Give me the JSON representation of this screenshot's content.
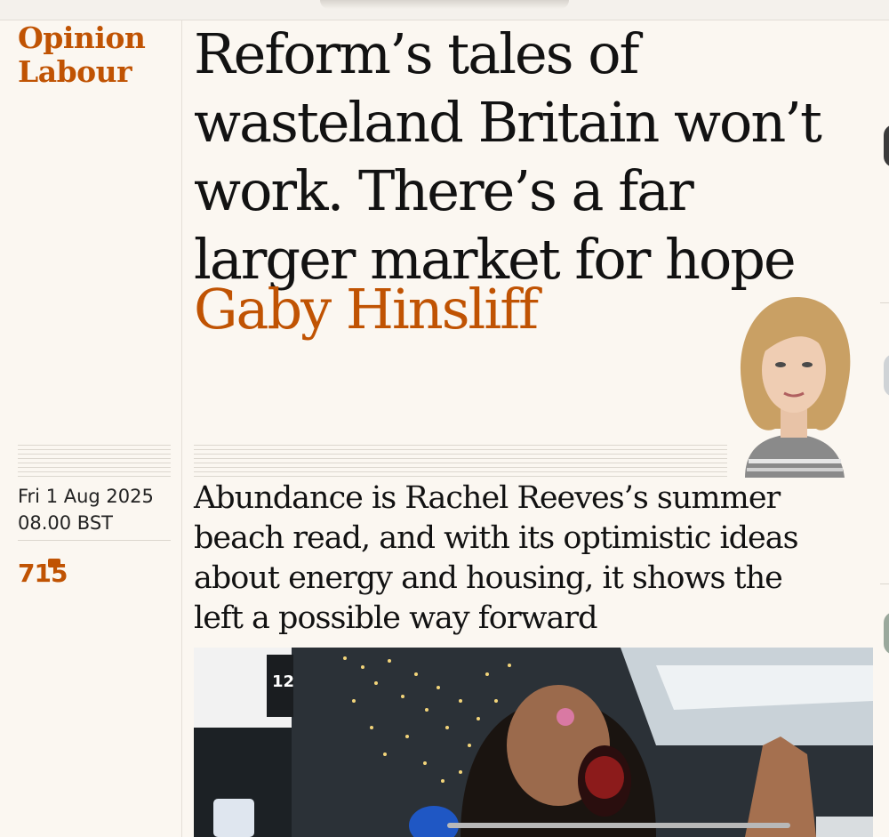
{
  "article": {
    "section": "Opinion",
    "subsection": "Labour",
    "headline": "Reform’s tales of wasteland Britain won’t work. There’s a far larger market for hope",
    "author": "Gaby Hinsliff",
    "date": "Fri 1 Aug 2025",
    "time": "08.00 BST",
    "comment_count": "715",
    "standfirst": "Abundance is Rachel Reeves’s summer beach read, and with its optimistic ideas about energy and housing, it shows the left a possible way forward"
  },
  "colors": {
    "accent": "#c05303",
    "background": "#fbf7f1",
    "text": "#121212"
  },
  "icons": [
    "comment-bubble-icon"
  ]
}
